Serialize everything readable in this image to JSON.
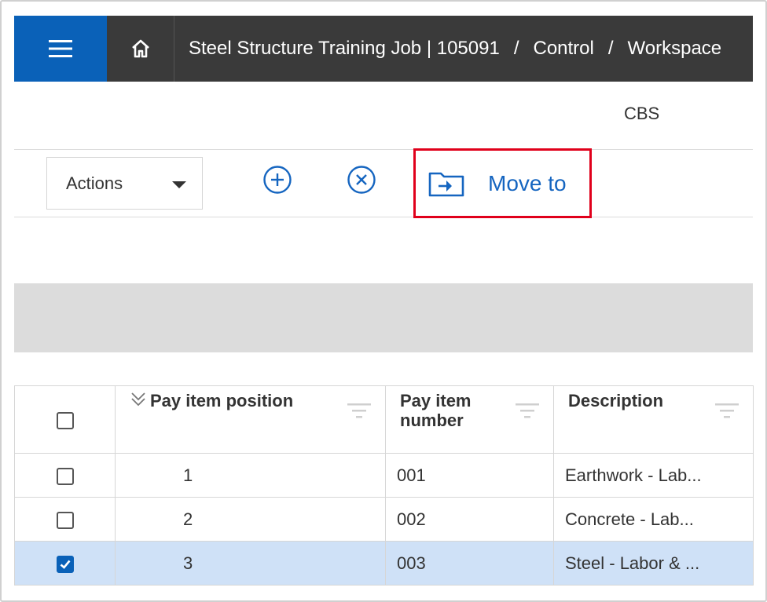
{
  "topbar": {
    "menu_icon": "hamburger-menu-icon",
    "home_icon": "home-icon",
    "breadcrumb": [
      "Steel Structure Training Job | 105091",
      "Control",
      "Workspace"
    ],
    "separator": "/"
  },
  "tab": {
    "label": "CBS"
  },
  "toolbar": {
    "actions_label": "Actions",
    "add_icon": "plus-circle-icon",
    "remove_icon": "x-circle-icon",
    "move_icon": "folder-move-icon",
    "move_label": "Move to",
    "highlight_color": "#e0001b"
  },
  "table": {
    "columns": [
      "Pay item position",
      "Pay item number",
      "Description"
    ],
    "rows": [
      {
        "checked": false,
        "position": "1",
        "number": "001",
        "description": "Earthwork - Lab..."
      },
      {
        "checked": false,
        "position": "2",
        "number": "002",
        "description": "Concrete - Lab..."
      },
      {
        "checked": true,
        "position": "3",
        "number": "003",
        "description": "Steel - Labor & ..."
      }
    ]
  },
  "colors": {
    "brand_blue": "#0a61b8",
    "topbar": "#3a3a3a",
    "link_blue": "#1565c0",
    "selected_row": "#cfe1f7"
  }
}
